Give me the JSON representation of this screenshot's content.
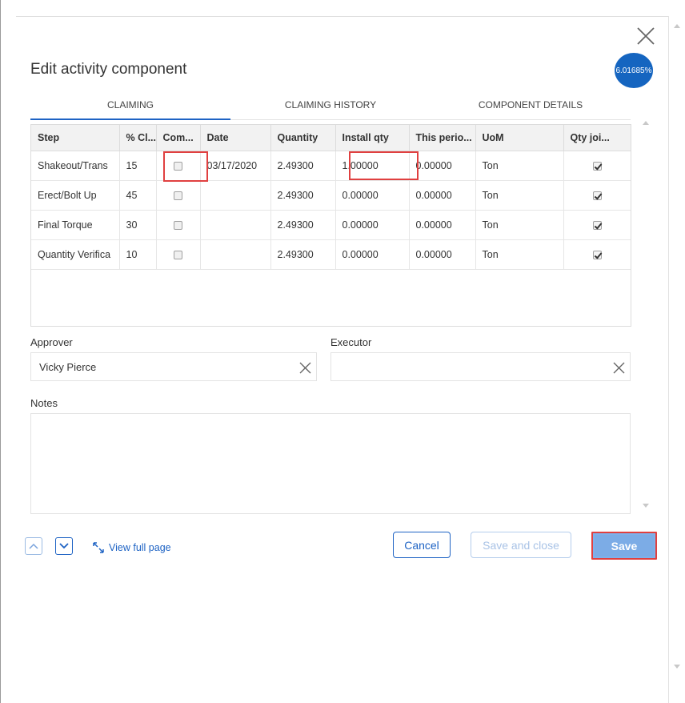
{
  "dialog": {
    "title": "Edit activity component",
    "progress_badge": "6.01685%",
    "progress_color": "#1565c0",
    "accent_color": "#1e63c4"
  },
  "tabs": [
    {
      "label": "CLAIMING",
      "active": true
    },
    {
      "label": "CLAIMING HISTORY",
      "active": false
    },
    {
      "label": "COMPONENT DETAILS",
      "active": false
    }
  ],
  "grid": {
    "columns": [
      "Step",
      "% Cl...",
      "Com...",
      "Date",
      "Quantity",
      "Install qty",
      "This perio...",
      "UoM",
      "Qty joi..."
    ],
    "rows": [
      {
        "step": "Shakeout/Trans",
        "pct": "15",
        "complete": false,
        "date": "03/17/2020",
        "quantity": "2.49300",
        "install_qty": "1.00000",
        "this_period": "0.00000",
        "uom": "Ton",
        "qty_joined": true
      },
      {
        "step": "Erect/Bolt Up",
        "pct": "45",
        "complete": false,
        "date": "",
        "quantity": "2.49300",
        "install_qty": "0.00000",
        "this_period": "0.00000",
        "uom": "Ton",
        "qty_joined": true
      },
      {
        "step": "Final Torque",
        "pct": "30",
        "complete": false,
        "date": "",
        "quantity": "2.49300",
        "install_qty": "0.00000",
        "this_period": "0.00000",
        "uom": "Ton",
        "qty_joined": true
      },
      {
        "step": "Quantity Verifica",
        "pct": "10",
        "complete": false,
        "date": "",
        "quantity": "2.49300",
        "install_qty": "0.00000",
        "this_period": "0.00000",
        "uom": "Ton",
        "qty_joined": true
      }
    ]
  },
  "form": {
    "approver_label": "Approver",
    "approver_value": "Vicky Pierce",
    "executor_label": "Executor",
    "executor_value": "",
    "notes_label": "Notes",
    "notes_value": ""
  },
  "footer": {
    "view_full_page": "View full page",
    "cancel": "Cancel",
    "save_and_close": "Save and close",
    "save": "Save"
  },
  "icons": {
    "close": "close-icon",
    "clear": "clear-icon",
    "prev": "chevron-up-icon",
    "next": "chevron-down-icon",
    "expand": "expand-icon"
  },
  "highlight_color": "#e04040"
}
